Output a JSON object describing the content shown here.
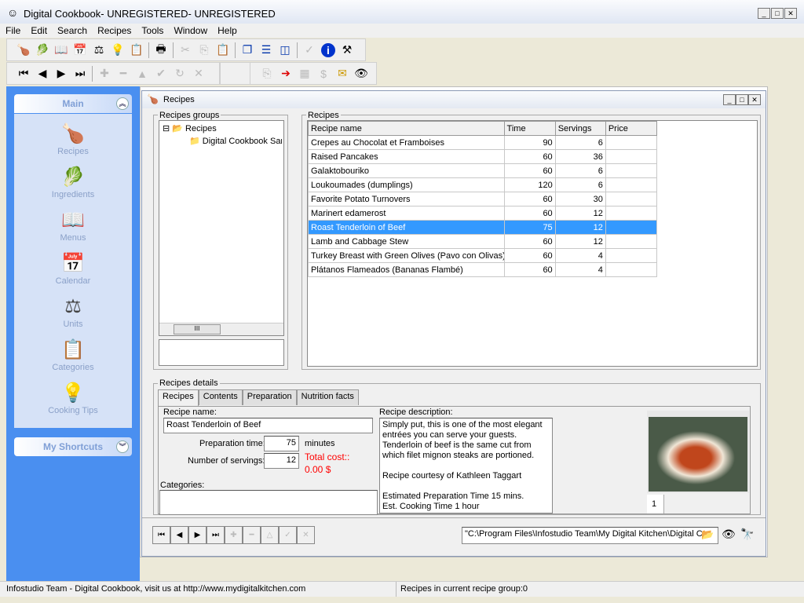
{
  "app": {
    "title": "Digital Cookbook- UNREGISTERED- UNREGISTERED"
  },
  "menu": [
    "File",
    "Edit",
    "Search",
    "Recipes",
    "Tools",
    "Window",
    "Help"
  ],
  "toolbar1": [
    "recipes-icon",
    "ingredients-icon",
    "menus-icon",
    "calendar-icon",
    "units-icon",
    "cooking-tips-icon",
    "categories-icon",
    "print-icon",
    "cut-icon",
    "copy-icon",
    "paste-icon",
    "cascade-icon",
    "tile-horizontal-icon",
    "tile-vertical-icon",
    "spellcheck-icon",
    "info-icon",
    "tools-icon"
  ],
  "sidebar": {
    "main_label": "Main",
    "items": [
      {
        "label": "Recipes",
        "icon": "🍗"
      },
      {
        "label": "Ingredients",
        "icon": "🥬"
      },
      {
        "label": "Menus",
        "icon": "📖"
      },
      {
        "label": "Calendar",
        "icon": "📅"
      },
      {
        "label": "Units",
        "icon": "⚖"
      },
      {
        "label": "Categories",
        "icon": "📋"
      },
      {
        "label": "Cooking Tips",
        "icon": "💡"
      }
    ],
    "shortcuts_label": "My Shortcuts"
  },
  "child": {
    "title": "Recipes"
  },
  "groups": {
    "label": "Recipes groups",
    "root": "Recipes",
    "child": "Digital Cookbook Sar"
  },
  "recipes": {
    "label": "Recipes",
    "columns": [
      "Recipe name",
      "Time",
      "Servings",
      "Price"
    ],
    "rows": [
      [
        "Crepes au Chocolat et Framboises",
        "90",
        "6",
        ""
      ],
      [
        "Raised Pancakes",
        "60",
        "36",
        ""
      ],
      [
        "Galaktobouriko",
        "60",
        "6",
        ""
      ],
      [
        "Loukoumades (dumplings)",
        "120",
        "6",
        ""
      ],
      [
        "Favorite Potato Turnovers",
        "60",
        "30",
        ""
      ],
      [
        "Marinert edamerost",
        "60",
        "12",
        ""
      ],
      [
        "Roast Tenderloin of Beef",
        "75",
        "12",
        ""
      ],
      [
        "Lamb and Cabbage Stew",
        "60",
        "12",
        ""
      ],
      [
        "Turkey Breast with Green Olives (Pavo con Olivas)",
        "60",
        "4",
        ""
      ],
      [
        "Plátanos Flameados (Bananas Flambé)",
        "60",
        "4",
        ""
      ]
    ],
    "selected_index": 6
  },
  "details": {
    "label": "Recipes details",
    "tabs": [
      "Recipes",
      "Contents",
      "Preparation",
      "Nutrition facts"
    ],
    "name_label": "Recipe name:",
    "name": "Roast Tenderloin of Beef",
    "prep_label": "Preparation time:",
    "prep": "75",
    "minutes": "minutes",
    "serv_label": "Number of servings:",
    "serv": "12",
    "cost_label": "Total cost::",
    "cost": "0.00 $",
    "categories_label": "Categories:",
    "desc_label": "Recipe description:",
    "desc": "Simply put, this is one of the most elegant entrées you can serve your guests. Tenderloin of beef is the same cut from which filet mignon steaks are portioned.\n\nRecipe courtesy of Kathleen Taggart\n\nEstimated Preparation Time 15 mins.\nEst. Cooking Time 1 hour",
    "image_index": "1",
    "path": "\"C:\\Program Files\\Infostudio Team\\My Digital Kitchen\\Digital C"
  },
  "status": {
    "left": "Infostudio Team - Digital Cookbook, visit us at http://www.mydigitalkitchen.com",
    "right": "Recipes in current recipe group:0"
  },
  "colors": {
    "accent": "#3399ff",
    "sidebar": "#4a8ff0",
    "cost": "#ff0000"
  }
}
